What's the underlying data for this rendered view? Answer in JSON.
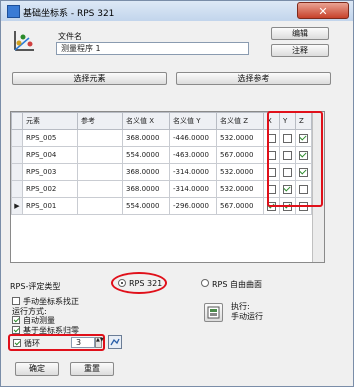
{
  "window": {
    "title": "基础坐标系 - RPS 321",
    "close_glyph": "✕"
  },
  "form": {
    "file_name_label": "文件名",
    "file_name_value": "测量程序 1",
    "edit_button": "编辑",
    "comment_button": "注释",
    "select_element_button": "选择元素",
    "select_reference_button": "选择参考"
  },
  "table": {
    "columns": [
      "元素",
      "参考",
      "名义值 X",
      "名义值 Y",
      "名义值 Z",
      "X",
      "Y",
      "Z"
    ],
    "rows": [
      {
        "marker": "",
        "element": "RPS_005",
        "reference": "",
        "x": "368.0000",
        "y": "-446.0000",
        "z": "532.0000",
        "cx": false,
        "cy": false,
        "cz": true
      },
      {
        "marker": "",
        "element": "RPS_004",
        "reference": "",
        "x": "554.0000",
        "y": "-463.0000",
        "z": "567.0000",
        "cx": false,
        "cy": false,
        "cz": true
      },
      {
        "marker": "",
        "element": "RPS_003",
        "reference": "",
        "x": "368.0000",
        "y": "-314.0000",
        "z": "532.0000",
        "cx": false,
        "cy": false,
        "cz": true
      },
      {
        "marker": "",
        "element": "RPS_002",
        "reference": "",
        "x": "368.0000",
        "y": "-314.0000",
        "z": "532.0000",
        "cx": false,
        "cy": true,
        "cz": false
      },
      {
        "marker": "▶",
        "element": "RPS_001",
        "reference": "",
        "x": "554.0000",
        "y": "-296.0000",
        "z": "567.0000",
        "cx": true,
        "cy": true,
        "cz": false
      }
    ]
  },
  "rps": {
    "type_label": "RPS-评定类型",
    "option_321": "RPS 321",
    "option_freeform": "RPS 自由曲面",
    "selected": "RPS 321"
  },
  "options": {
    "manual_align_label": "手动坐标系找正",
    "run_mode_label": "运行方式:",
    "auto_measure_label": "自动测量",
    "based_on_label": "基于坐标系归零",
    "auto_measure_checked": true,
    "based_on_checked": true,
    "manual_align_checked": false,
    "loop_label": "循环",
    "loop_checked": true,
    "loop_count": "3"
  },
  "execute": {
    "label_line1": "执行:",
    "label_line2": "手动运行"
  },
  "footer": {
    "ok_button": "确定",
    "reset_button": "重置"
  },
  "colors": {
    "highlight": "#e0101a",
    "check": "#2a8a2a"
  }
}
